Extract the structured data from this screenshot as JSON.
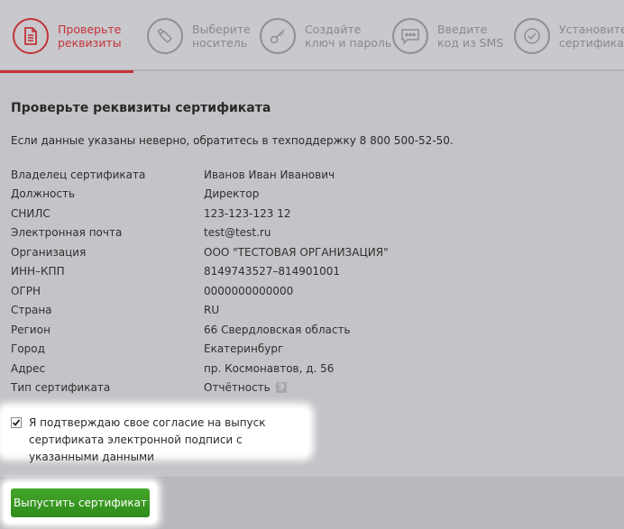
{
  "stepper": {
    "steps": [
      {
        "label": "Проверьте\nреквизиты",
        "icon": "document-icon"
      },
      {
        "label": "Выберите\nноситель",
        "icon": "usb-icon"
      },
      {
        "label": "Создайте\nключ и пароль",
        "icon": "key-icon"
      },
      {
        "label": "Введите\nкод из SMS",
        "icon": "sms-icon"
      },
      {
        "label": "Установите\nсертификат",
        "icon": "check-icon"
      }
    ]
  },
  "main": {
    "title": "Проверьте реквизиты сертификата",
    "notice": "Если данные указаны неверно, обратитесь в техподдержку 8 800 500-52-50.",
    "details": [
      {
        "label": "Владелец сертификата",
        "value": "Иванов Иван Иванович"
      },
      {
        "label": "Должность",
        "value": "Директор"
      },
      {
        "label": "СНИЛС",
        "value": "123-123-123 12"
      },
      {
        "label": "Электронная почта",
        "value": "test@test.ru"
      },
      {
        "label": "Организация",
        "value": "ООО \"ТЕСТОВАЯ ОРГАНИЗАЦИЯ\""
      },
      {
        "label": "ИНН–КПП",
        "value": "8149743527–814901001"
      },
      {
        "label": "ОГРН",
        "value": "0000000000000"
      },
      {
        "label": "Страна",
        "value": "RU"
      },
      {
        "label": "Регион",
        "value": "66 Свердловская область"
      },
      {
        "label": "Город",
        "value": "Екатеринбург"
      },
      {
        "label": "Адрес",
        "value": "пр. Космонавтов, д. 56"
      },
      {
        "label": "Тип сертификата",
        "value": "Отчётность",
        "badge": "Э"
      }
    ],
    "consent": {
      "checked": true,
      "text": "Я подтверждаю свое согласие на выпуск сертификата электронной подписи с указанными данными"
    }
  },
  "footer": {
    "issue_label": "Выпустить сертификат"
  },
  "colors": {
    "accent": "#c3333a",
    "button": "#38991f"
  }
}
